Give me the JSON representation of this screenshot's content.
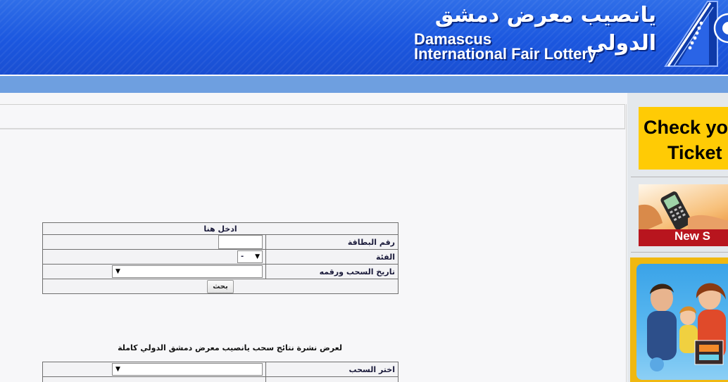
{
  "header": {
    "title_arabic": "يانصيب معرض دمشق الدولي",
    "title_en_line1": "Damascus",
    "title_en_line2": "International Fair Lottery"
  },
  "search_form": {
    "heading": "ادخل هنا",
    "card_number_label": "رقم البطاقة",
    "card_number_value": "",
    "category_label": "الفئة",
    "category_selected": "-",
    "draw_label": "تاريخ السحب ورقمه",
    "draw_selected": "",
    "search_button": "بحث"
  },
  "results_note": "لعرض نشرة نتائج سحب يانصيب معرض دمشق الدولي كاملة",
  "bulletin_form": {
    "choose_draw_label": "اختر السحب",
    "choose_draw_selected": ""
  },
  "sidebar": {
    "check_ticket_line1": "Check yo",
    "check_ticket_line2": "Ticket",
    "phone_ad_text": "New S"
  },
  "colors": {
    "header_blue": "#1b57df",
    "nav_blue": "#6e9fe0",
    "ad_yellow": "#ffcb05",
    "ad_red": "#b8151e"
  },
  "icons": {
    "logo": "fair-logo-icon",
    "dropdown": "chevron-down-icon"
  }
}
